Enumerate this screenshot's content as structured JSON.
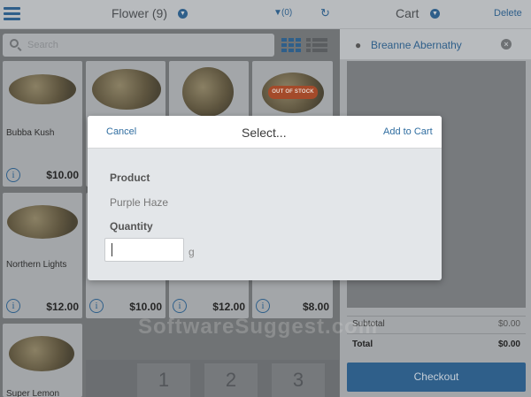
{
  "header": {
    "title": "Flower (9)",
    "filter_label": "(0)",
    "cart_title": "Cart",
    "delete_label": "Delete"
  },
  "search": {
    "placeholder": "Search"
  },
  "products": [
    {
      "name": "Bubba Kush",
      "price": "$10.00",
      "out_of_stock": false
    },
    {
      "name": "",
      "price": "",
      "out_of_stock": false
    },
    {
      "name": "",
      "price": "",
      "out_of_stock": false
    },
    {
      "name": "",
      "price": "",
      "out_of_stock": true
    },
    {
      "name": "Northern Lights",
      "price": "$12.00",
      "out_of_stock": false
    },
    {
      "name": "",
      "price": "$10.00",
      "out_of_stock": false
    },
    {
      "name": "",
      "price": "$12.00",
      "out_of_stock": false
    },
    {
      "name": "",
      "price": "$8.00",
      "out_of_stock": false
    },
    {
      "name": "Super Lemon",
      "price": "",
      "out_of_stock": false
    }
  ],
  "out_of_stock_label": "OUT OF STOCK",
  "keypad": [
    "1",
    "2",
    "3"
  ],
  "cart": {
    "customer_name": "Breanne Abernathy",
    "subtotal_label": "Subtotal",
    "subtotal_value": "$0.00",
    "total_label": "Total",
    "total_value": "$0.00",
    "checkout_label": "Checkout"
  },
  "watermark": "SoftwareSuggest.com",
  "modal": {
    "cancel_label": "Cancel",
    "title": "Select...",
    "add_label": "Add to Cart",
    "product_label": "Product",
    "product_value": "Purple Haze",
    "quantity_label": "Quantity",
    "quantity_value": "",
    "quantity_unit": "g"
  },
  "colors": {
    "accent": "#2f6da0",
    "brand": "#2f5f8a",
    "out_of_stock": "#a44a2a"
  }
}
